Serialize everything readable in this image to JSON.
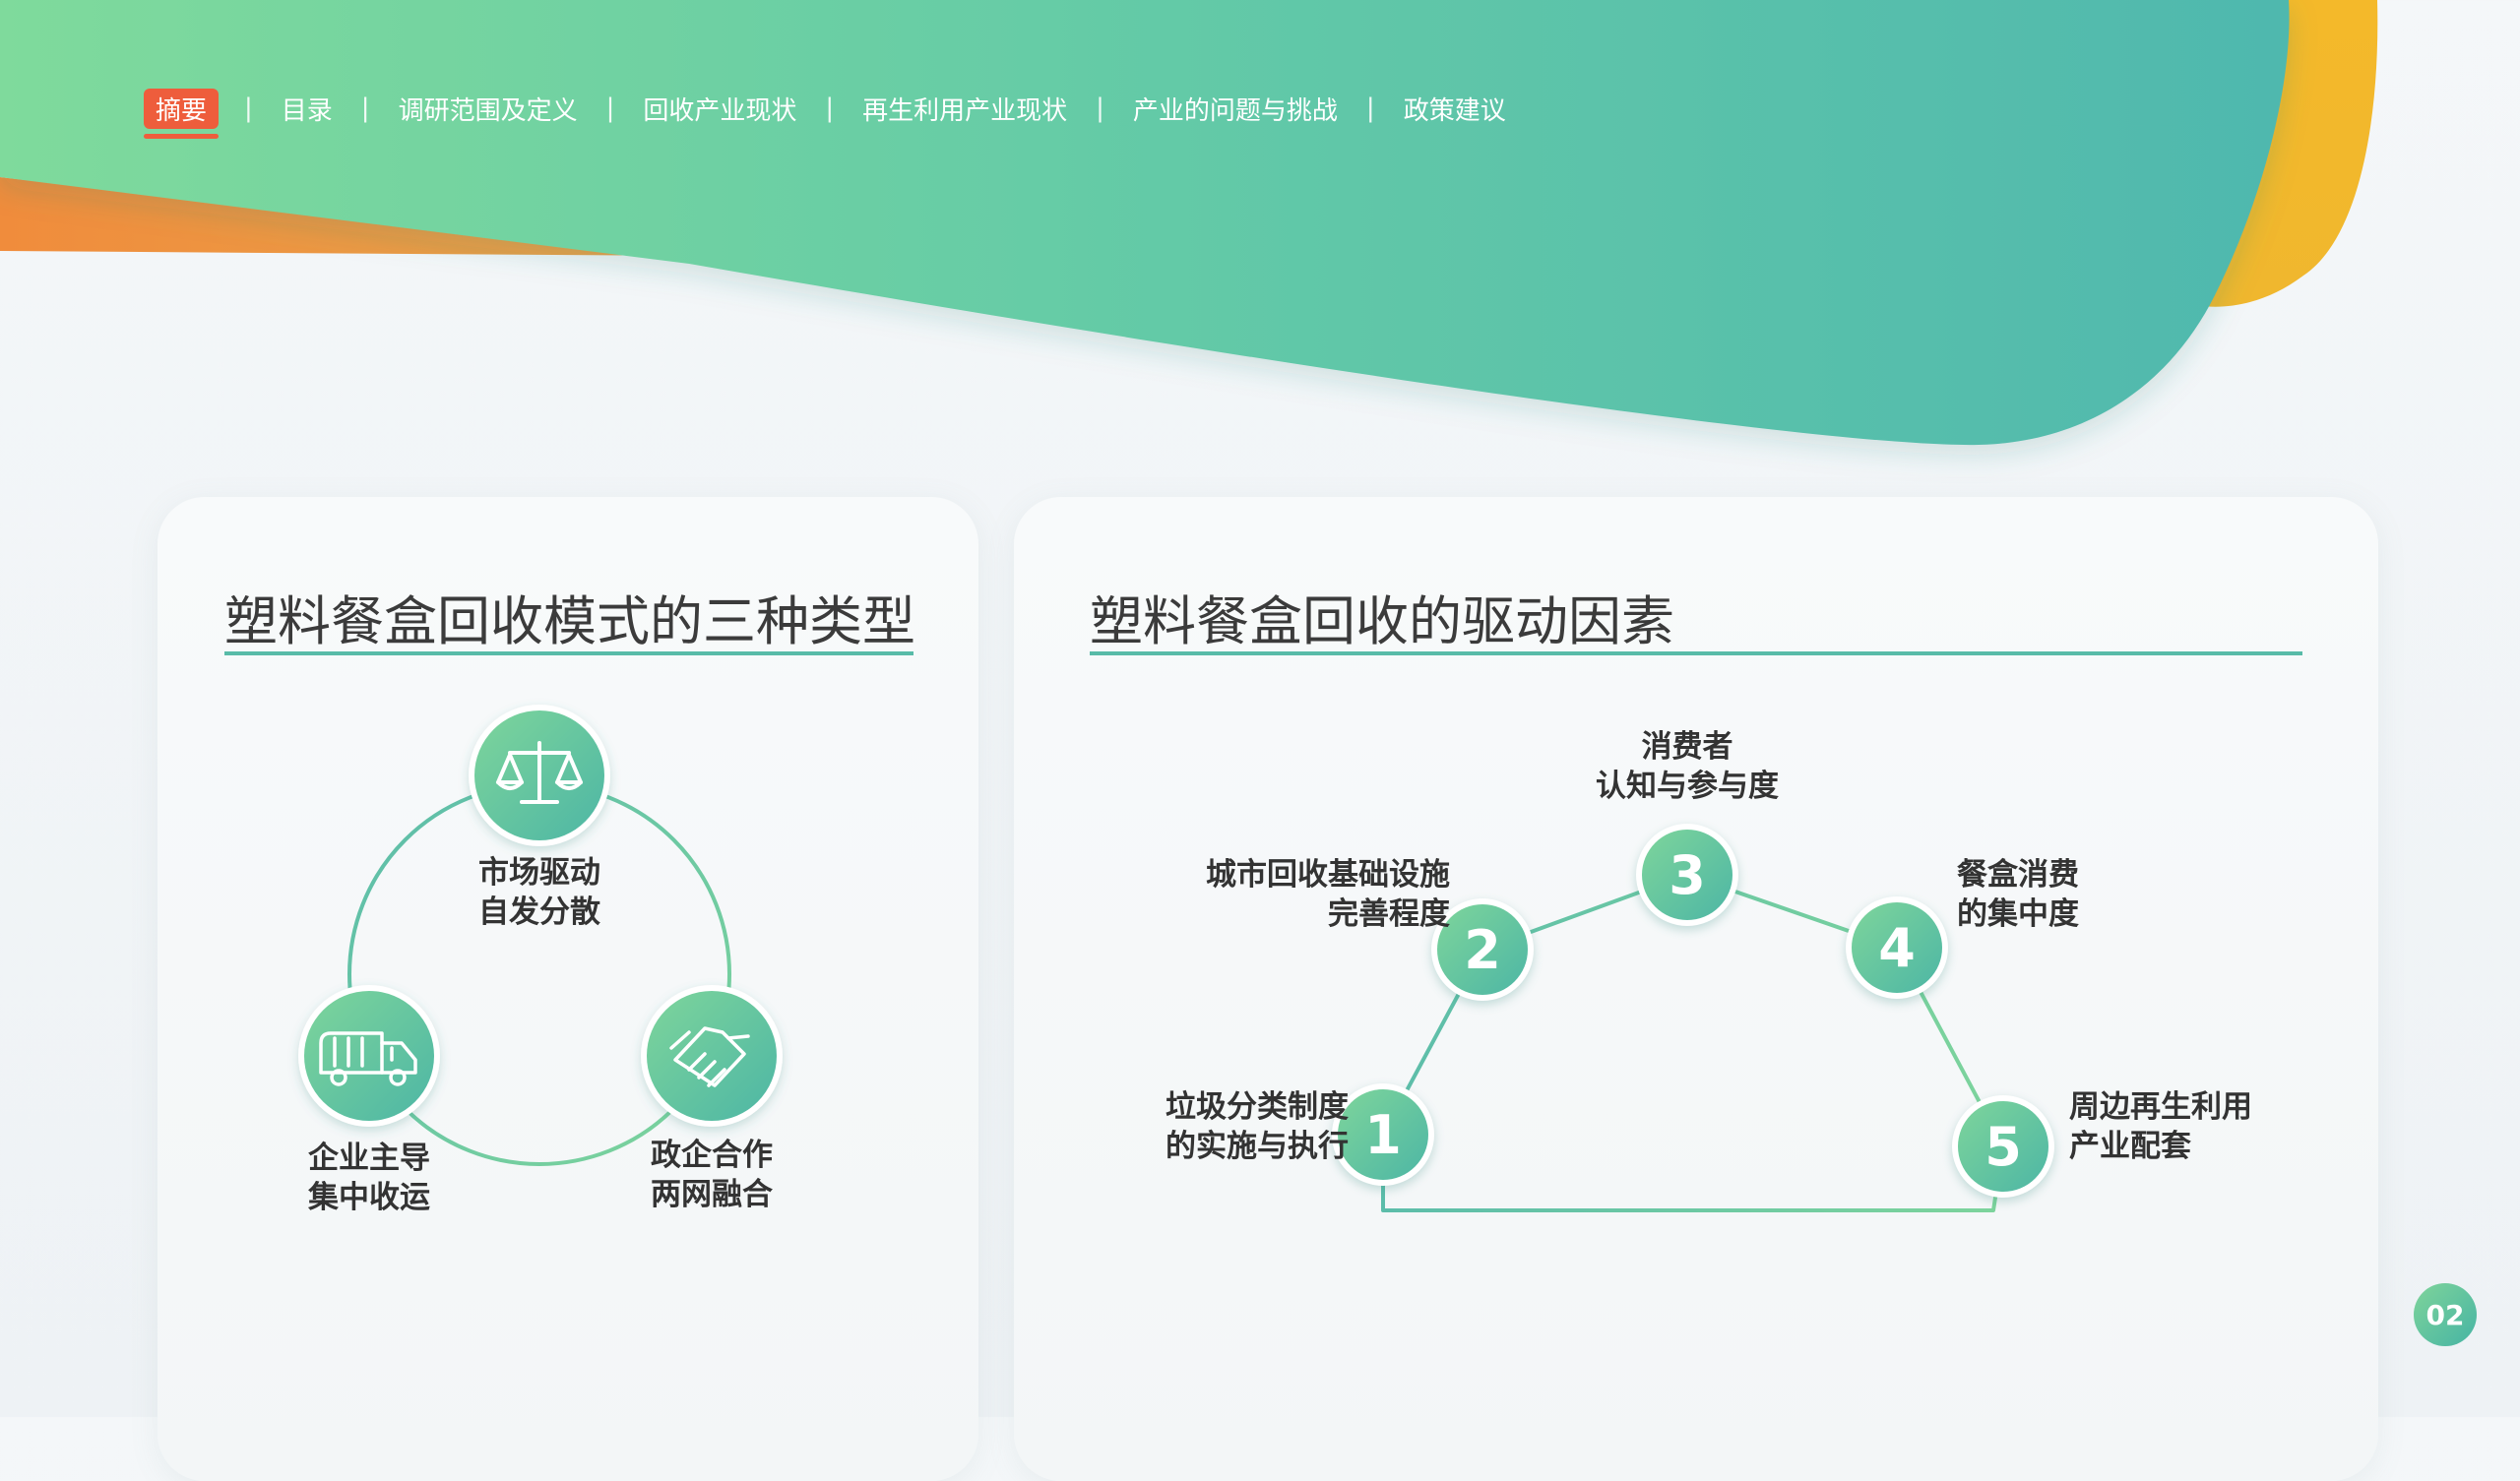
{
  "nav": {
    "items": [
      "摘要",
      "目录",
      "调研范围及定义",
      "回收产业现状",
      "再生利用产业现状",
      "产业的问题与挑战",
      "政策建议"
    ],
    "separator": "|",
    "active_index": 0
  },
  "left_card": {
    "title": "塑料餐盒回收模式的三种类型",
    "nodes": [
      {
        "icon": "scale-icon",
        "line1": "市场驱动",
        "line2": "自发分散"
      },
      {
        "icon": "garbage-truck-icon",
        "line1": "企业主导",
        "line2": "集中收运"
      },
      {
        "icon": "handshake-icon",
        "line1": "政企合作",
        "line2": "两网融合"
      }
    ]
  },
  "right_card": {
    "title": "塑料餐盒回收的驱动因素",
    "steps": [
      {
        "number": "1",
        "line1": "垃圾分类制度",
        "line2": "的实施与执行"
      },
      {
        "number": "2",
        "line1": "城市回收基础设施",
        "line2": "完善程度"
      },
      {
        "number": "3",
        "line1": "消费者",
        "line2": "认知与参与度"
      },
      {
        "number": "4",
        "line1": "餐盒消费",
        "line2": "的集中度"
      },
      {
        "number": "5",
        "line1": "周边再生利用",
        "line2": "产业配套"
      }
    ]
  },
  "page_number": "02",
  "colors": {
    "accent_teal": "#58bba8",
    "accent_green": "#7dd79b",
    "nav_active": "#ee5d3c",
    "orange": "#f0913c",
    "yellow": "#f2b92c"
  }
}
